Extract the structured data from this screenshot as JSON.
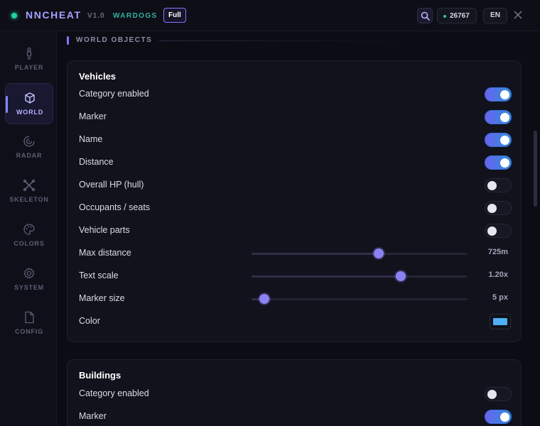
{
  "app": {
    "brand": "NNCHEAT",
    "version": "V1.0",
    "game": "WARDOGS",
    "badge": "Full",
    "counter": "26767",
    "language": "EN"
  },
  "sidebar": {
    "items": [
      {
        "label": "PLAYER",
        "icon": "person-icon",
        "active": false
      },
      {
        "label": "WORLD",
        "icon": "cube-icon",
        "active": true
      },
      {
        "label": "RADAR",
        "icon": "radar-icon",
        "active": false
      },
      {
        "label": "SKELETON",
        "icon": "skeleton-icon",
        "active": false
      },
      {
        "label": "COLORS",
        "icon": "palette-icon",
        "active": false
      },
      {
        "label": "SYSTEM",
        "icon": "gear-icon",
        "active": false
      },
      {
        "label": "CONFIG",
        "icon": "file-icon",
        "active": false
      }
    ]
  },
  "section": {
    "title": "WORLD OBJECTS"
  },
  "vehicles": {
    "title": "Vehicles",
    "toggles": [
      {
        "label": "Category enabled",
        "on": true
      },
      {
        "label": "Marker",
        "on": true
      },
      {
        "label": "Name",
        "on": true
      },
      {
        "label": "Distance",
        "on": true
      },
      {
        "label": "Overall HP (hull)",
        "on": false
      },
      {
        "label": "Occupants / seats",
        "on": false
      },
      {
        "label": "Vehicle parts",
        "on": false
      }
    ],
    "sliders": [
      {
        "label": "Max distance",
        "value": "725m",
        "fraction": 0.59
      },
      {
        "label": "Text scale",
        "value": "1.20x",
        "fraction": 0.69
      },
      {
        "label": "Marker size",
        "value": "5 px",
        "fraction": 0.06
      }
    ],
    "color": {
      "label": "Color",
      "value": "#4fb0f5"
    }
  },
  "buildings": {
    "title": "Buildings",
    "toggles": [
      {
        "label": "Category enabled",
        "on": false
      },
      {
        "label": "Marker",
        "on": true
      }
    ]
  }
}
